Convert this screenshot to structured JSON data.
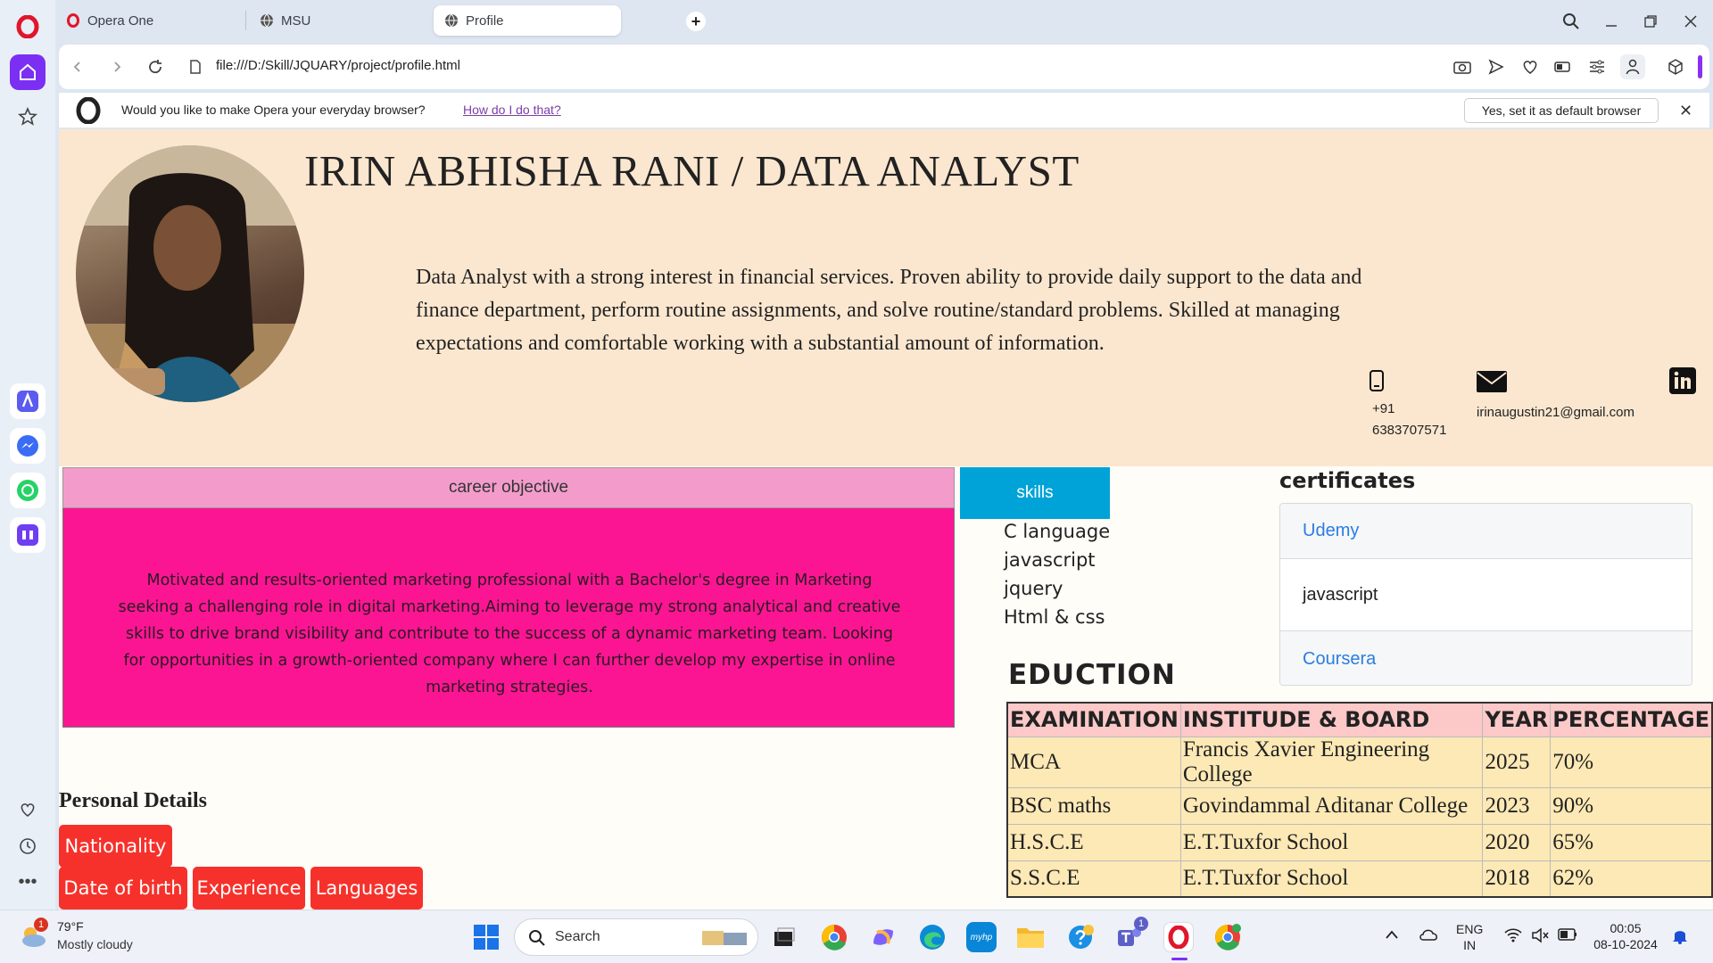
{
  "browser": {
    "tabs": [
      {
        "label": "Opera One",
        "icon": "opera-logo-icon"
      },
      {
        "label": "MSU",
        "icon": "globe-icon"
      },
      {
        "label": "Profile",
        "icon": "globe-icon",
        "active": true
      }
    ],
    "url": "file:///D:/Skill/JQUARY/project/profile.html",
    "infobar": {
      "question": "Would you like to make Opera your everyday browser?",
      "link": "How do I do that?",
      "button": "Yes, set it as default browser"
    }
  },
  "profile": {
    "name_title": "IRIN ABHISHA RANI / DATA ANALYST",
    "summary": "Data Analyst with a strong interest in financial services. Proven ability to provide daily support to the data and finance department, perform routine assignments, and solve routine/standard problems. Skilled at managing expectations and comfortable working with a substantial amount of information.",
    "phone_line1": "+91",
    "phone_line2": "6383707571",
    "email": "irinaugustin21@gmail.com",
    "career_heading": "career objective",
    "career_text": "Motivated and results-oriented marketing professional with a Bachelor's degree in Marketing seeking a challenging role in digital marketing.Aiming to leverage my strong analytical and creative skills to drive brand visibility and contribute to the success of a dynamic marketing team. Looking for opportunities in a growth-oriented company where I can further develop my expertise in online marketing strategies.",
    "skills_heading": "skills",
    "skills": [
      "C language",
      "javascript",
      "jquery",
      "Html & css"
    ],
    "certificates_heading": "certificates",
    "certificates": [
      "Udemy",
      "javascript",
      "Coursera"
    ],
    "education_heading": "EDUCTION",
    "education_columns": [
      "EXAMINATION",
      "INSTITUDE & BOARD",
      "YEAR",
      "PERCENTAGE"
    ],
    "education_rows": [
      [
        "MCA",
        "Francis Xavier Engineering College",
        "2025",
        "70%"
      ],
      [
        "BSC maths",
        "Govindammal Aditanar College",
        "2023",
        "90%"
      ],
      [
        "H.S.C.E",
        "E.T.Tuxfor School",
        "2020",
        "65%"
      ],
      [
        "S.S.C.E",
        "E.T.Tuxfor School",
        "2018",
        "62%"
      ]
    ],
    "personal_heading": "Personal Details",
    "personal_buttons": [
      "Nationality",
      "Date of birth",
      "Experience",
      "Languages"
    ]
  },
  "taskbar": {
    "weather_temp": "79°F",
    "weather_desc": "Mostly cloudy",
    "weather_badge": "1",
    "search_placeholder": "Search",
    "lang_line1": "ENG",
    "lang_line2": "IN",
    "time": "00:05",
    "date": "08-10-2024",
    "teams_badge": "1"
  },
  "colors": {
    "header_bg": "#fbe7cf",
    "career_header": "#f39ccc",
    "career_body": "#fb1593",
    "skills_button": "#00a3d8",
    "personal_button": "#f6312b",
    "edu_header": "#fcc8c8",
    "edu_body": "#fde9b5",
    "link": "#2a7de1",
    "opera_red": "#e0162b"
  }
}
